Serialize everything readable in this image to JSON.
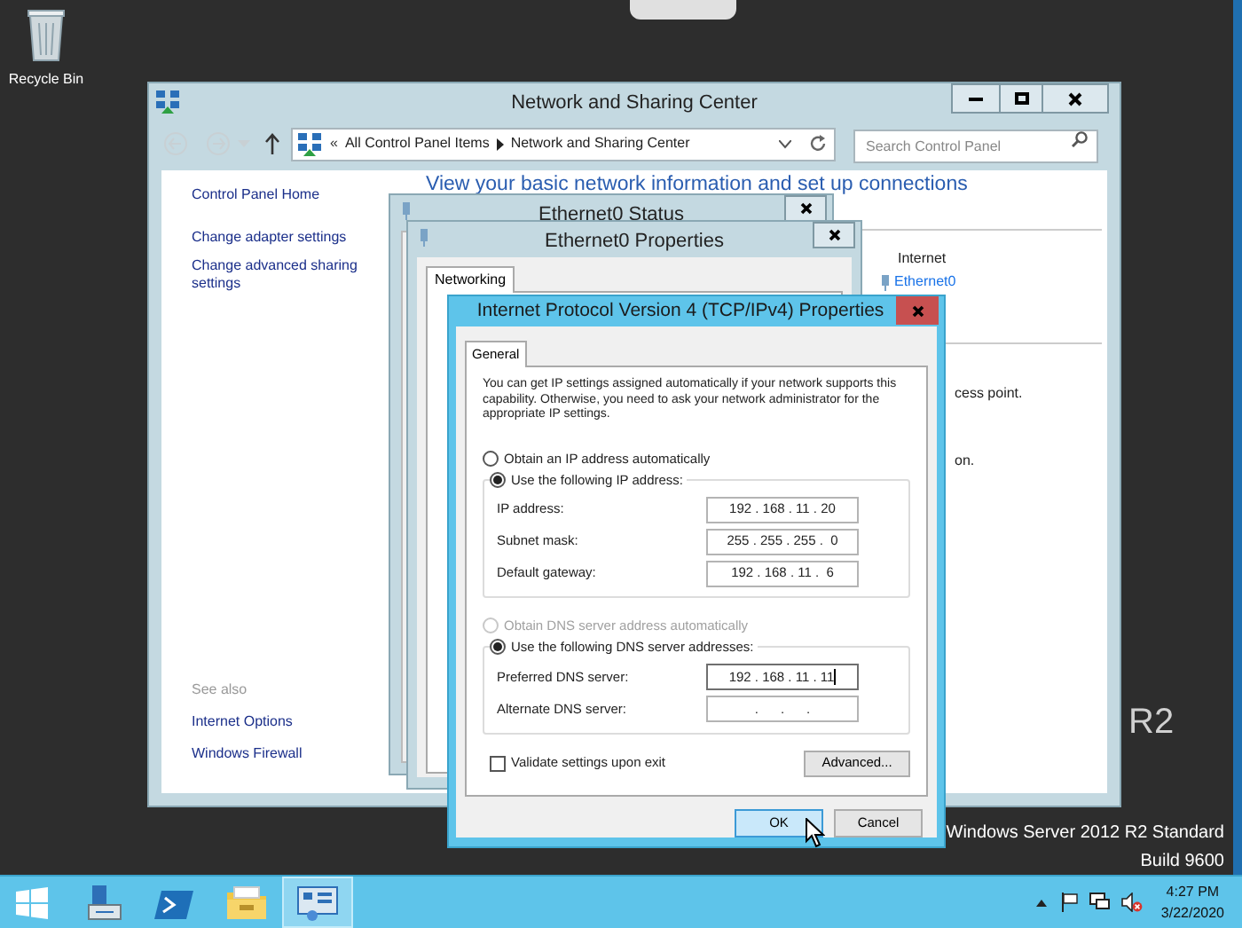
{
  "desktop": {
    "icons": [
      {
        "label": "Recycle Bin"
      }
    ],
    "branding": [
      {
        "text": "R2",
        "kind": "big"
      },
      {
        "text": "Windows Server 2012 R2 Standard",
        "kind": "small"
      },
      {
        "text": "Build 9600",
        "kind": "small"
      }
    ]
  },
  "network_center": {
    "title": "Network and Sharing Center",
    "address": {
      "chevron": "«",
      "path": [
        "All Control Panel Items",
        "Network and Sharing Center"
      ]
    },
    "search": {
      "placeholder": "Search Control Panel"
    },
    "sidebar": {
      "items": [
        "Control Panel Home",
        "Change adapter settings",
        "Change advanced sharing settings"
      ],
      "see_also": {
        "title": "See also",
        "links": [
          "Internet Options",
          "Windows Firewall"
        ]
      }
    },
    "heading": "View your basic network information and set up connections",
    "network": {
      "label": "Internet",
      "link": "Ethernet0"
    },
    "fragments": [
      "cess point.",
      "on."
    ]
  },
  "status_window": {
    "title": "Ethernet0 Status"
  },
  "properties_window": {
    "title": "Ethernet0 Properties",
    "tabs": [
      {
        "label": "Networking",
        "selected": true
      }
    ]
  },
  "ipv4_dialog": {
    "title": "Internet Protocol Version 4 (TCP/IPv4) Properties",
    "tabs": [
      {
        "label": "General",
        "selected": true
      }
    ],
    "description": "You can get IP settings assigned automatically if your network supports this capability. Otherwise, you need to ask your network administrator for the appropriate IP settings.",
    "ip_options": [
      {
        "label": "Obtain an IP address automatically",
        "selected": false,
        "disabled": false
      },
      {
        "label": "Use the following IP address:",
        "selected": true,
        "disabled": false
      }
    ],
    "ip_fields": [
      {
        "label": "IP address:",
        "value": "192 . 168 . 11 . 20",
        "focused": false
      },
      {
        "label": "Subnet mask:",
        "value": "255 . 255 . 255 .  0",
        "focused": false
      },
      {
        "label": "Default gateway:",
        "value": "192 . 168 . 11 .  6",
        "focused": false
      }
    ],
    "dns_options": [
      {
        "label": "Obtain DNS server address automatically",
        "selected": false,
        "disabled": true
      },
      {
        "label": "Use the following DNS server addresses:",
        "selected": true,
        "disabled": false
      }
    ],
    "dns_fields": [
      {
        "label": "Preferred DNS server:",
        "value": "192 . 168 . 11 . 11",
        "focused": true
      },
      {
        "label": "Alternate DNS server:",
        "value": ".      .      .",
        "focused": false
      }
    ],
    "validate": {
      "label": "Validate settings upon exit",
      "checked": false
    },
    "advanced_button": "Advanced...",
    "buttons": [
      {
        "label": "OK",
        "default": true
      },
      {
        "label": "Cancel",
        "default": false
      }
    ]
  },
  "taskbar": {
    "apps": [
      {
        "kind": "server-manager",
        "selected": false
      },
      {
        "kind": "powershell",
        "selected": false
      },
      {
        "kind": "explorer",
        "selected": false
      },
      {
        "kind": "network",
        "selected": true
      }
    ],
    "clock": {
      "time": "4:27 PM",
      "date": "3/22/2020"
    }
  }
}
